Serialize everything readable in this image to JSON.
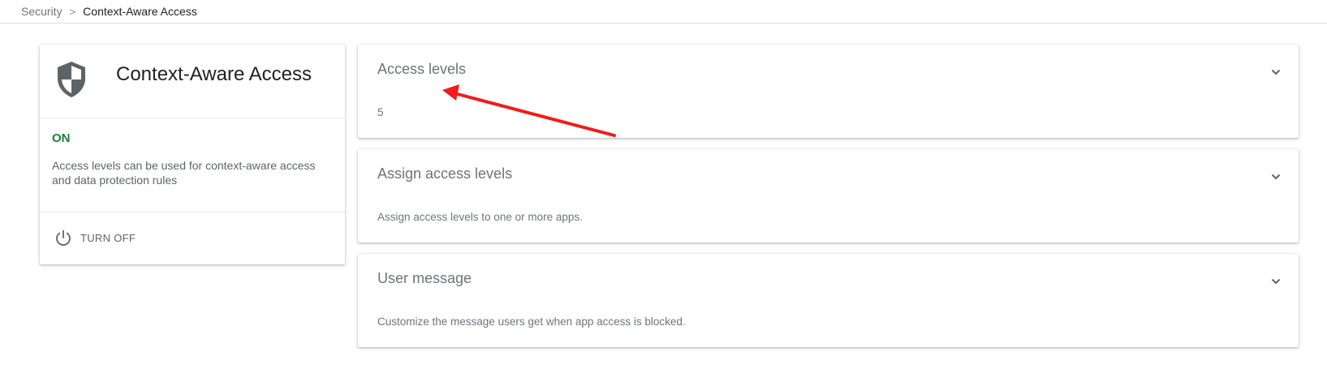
{
  "breadcrumb": {
    "parent": "Security",
    "separator": ">",
    "current": "Context-Aware Access"
  },
  "summary_card": {
    "icon": "shield-icon",
    "title": "Context-Aware Access",
    "status": "ON",
    "description": "Access levels can be used for context-aware access and data protection rules",
    "action_icon": "power-icon",
    "action_label": "TURN OFF"
  },
  "panels": [
    {
      "title": "Access levels",
      "subtitle": "5"
    },
    {
      "title": "Assign access levels",
      "subtitle": "Assign access levels to one or more apps."
    },
    {
      "title": "User message",
      "subtitle": "Customize the message users get when app access is blocked."
    }
  ],
  "colors": {
    "status_on": "#188038",
    "annotation_arrow": "#f21b1b",
    "shield": "#5f6368"
  }
}
